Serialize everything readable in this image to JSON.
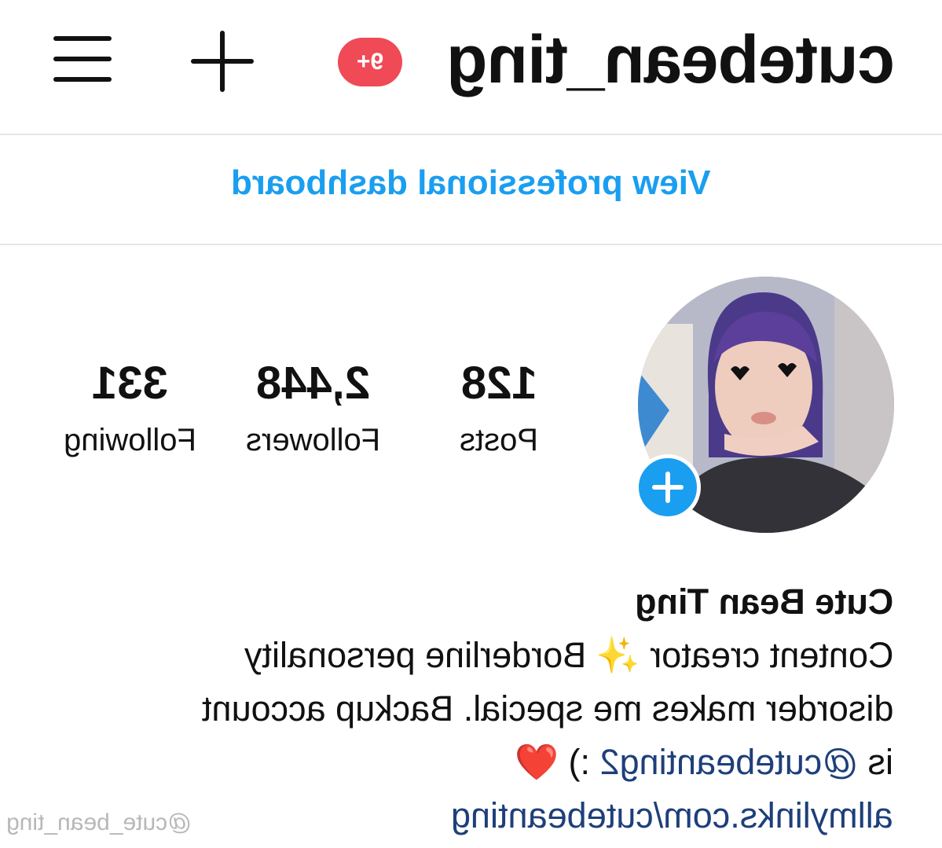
{
  "header": {
    "username": "cutebean_ting",
    "notification_badge": "9+",
    "menu_icon": "hamburger-menu-icon",
    "create_icon": "plus-icon"
  },
  "dashboard_link": "View professional dashboard",
  "profile": {
    "add_story_icon": "plus-icon",
    "stats": [
      {
        "value": "128",
        "label": "Posts"
      },
      {
        "value": "2,448",
        "label": "Followers"
      },
      {
        "value": "331",
        "label": "Following"
      }
    ]
  },
  "bio": {
    "name": "Cute Bean Ting",
    "line1": "Content creator ✨ Borderline personality",
    "line2": "disorder makes me special.  Backup account",
    "line3_prefix": "is ",
    "line3_handle": "@cutebeanting2",
    "line3_suffix": " :) ❤️",
    "link": "allmylinks.com/cutebeanting"
  },
  "watermark": "@cute_bean_ting",
  "colors": {
    "link_blue": "#1a9ef0",
    "badge_red": "#ef4a56",
    "handle_blue": "#1e3f7a"
  }
}
